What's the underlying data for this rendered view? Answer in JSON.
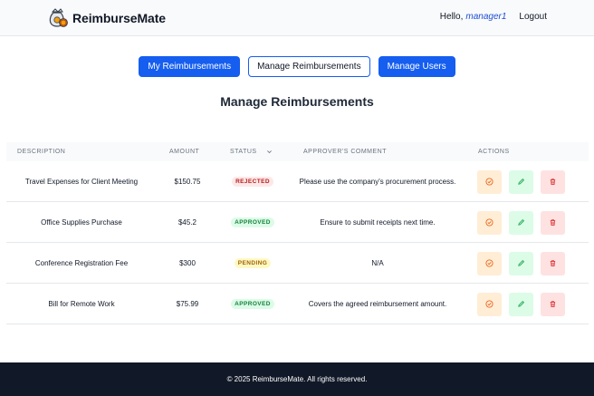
{
  "app": {
    "name": "ReimburseMate"
  },
  "nav": {
    "greeting": "Hello,",
    "username": "manager1",
    "logout": "Logout"
  },
  "tabs": [
    {
      "label": "My Reimbursements",
      "style": "primary"
    },
    {
      "label": "Manage Reimbursements",
      "style": "outline"
    },
    {
      "label": "Manage Users",
      "style": "primary"
    }
  ],
  "page": {
    "title": "Manage Reimbursements"
  },
  "table": {
    "headers": {
      "description": "DESCRIPTION",
      "amount": "AMOUNT",
      "status": "STATUS",
      "comment": "APPROVER'S COMMENT",
      "actions": "ACTIONS"
    },
    "rows": [
      {
        "description": "Travel Expenses for Client Meeting",
        "amount": "$150.75",
        "status": "REJECTED",
        "comment": "Please use the company's procurement process."
      },
      {
        "description": "Office Supplies Purchase",
        "amount": "$45.2",
        "status": "APPROVED",
        "comment": "Ensure to submit receipts next time."
      },
      {
        "description": "Conference Registration Fee",
        "amount": "$300",
        "status": "PENDING",
        "comment": "N/A"
      },
      {
        "description": "Bill for Remote Work",
        "amount": "$75.99",
        "status": "APPROVED",
        "comment": "Covers the agreed reimbursement amount."
      }
    ]
  },
  "footer": {
    "text": "© 2025 ReimburseMate. All rights reserved."
  },
  "colors": {
    "primary": "#155eef",
    "footer_bg": "#111827",
    "rejected": "#b91c1c",
    "approved": "#15803d",
    "pending": "#a16207"
  },
  "icons": {
    "logo": "money-bag-icon",
    "sort": "chevron-down-icon",
    "approve": "check-circle-icon",
    "edit": "pencil-icon",
    "delete": "trash-icon"
  }
}
